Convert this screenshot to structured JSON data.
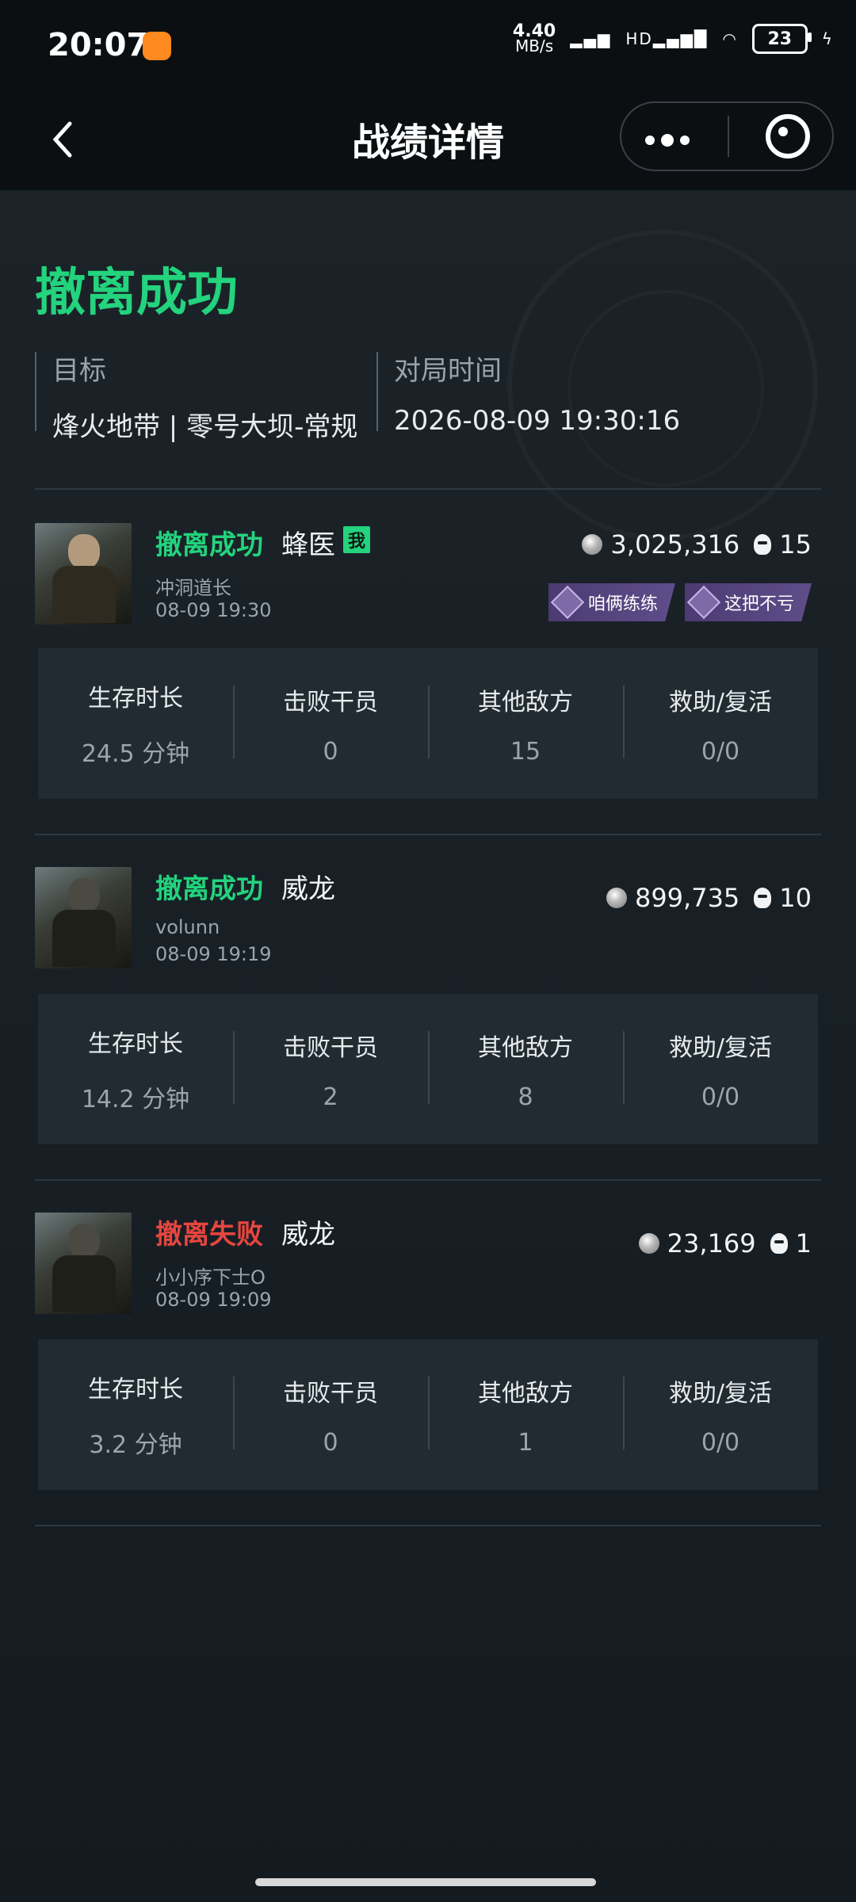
{
  "statusbar": {
    "time": "20:07",
    "net_speed_top": "4.40",
    "net_speed_bottom": "MB/s",
    "signal_text": "HD",
    "battery": "23"
  },
  "header": {
    "title": "战绩详情"
  },
  "summary": {
    "headline": "撤离成功",
    "target_label": "目标",
    "target_value": "烽火地带 | 零号大坝-常规",
    "time_label": "对局时间",
    "time_value": "2026-08-09 19:30:16"
  },
  "stat_labels": {
    "survival": "生存时长",
    "operators": "击败干员",
    "enemies": "其他敌方",
    "assist": "救助/复活"
  },
  "matches": [
    {
      "status": "撤离成功",
      "operator": "蜂医",
      "me_tag": "我",
      "player": "冲洞道长",
      "time": "08-09 19:30",
      "value": "3,025,316",
      "kills": "15",
      "badges": [
        "咱俩练练",
        "这把不亏"
      ],
      "stats": {
        "survival": "24.5 分钟",
        "operators": "0",
        "enemies": "15",
        "assist": "0/0"
      }
    },
    {
      "status": "撤离成功",
      "operator": "威龙",
      "player": "volunn",
      "time": "08-09 19:19",
      "value": "899,735",
      "kills": "10",
      "stats": {
        "survival": "14.2 分钟",
        "operators": "2",
        "enemies": "8",
        "assist": "0/0"
      }
    },
    {
      "status": "撤离失败",
      "operator": "威龙",
      "player": "小小序下士O",
      "time": "08-09 19:09",
      "value": "23,169",
      "kills": "1",
      "stats": {
        "survival": "3.2 分钟",
        "operators": "0",
        "enemies": "1",
        "assist": "0/0"
      }
    }
  ],
  "colors": {
    "success": "#23d37d",
    "fail": "#e6463f",
    "badge": "#5f4d8a"
  }
}
